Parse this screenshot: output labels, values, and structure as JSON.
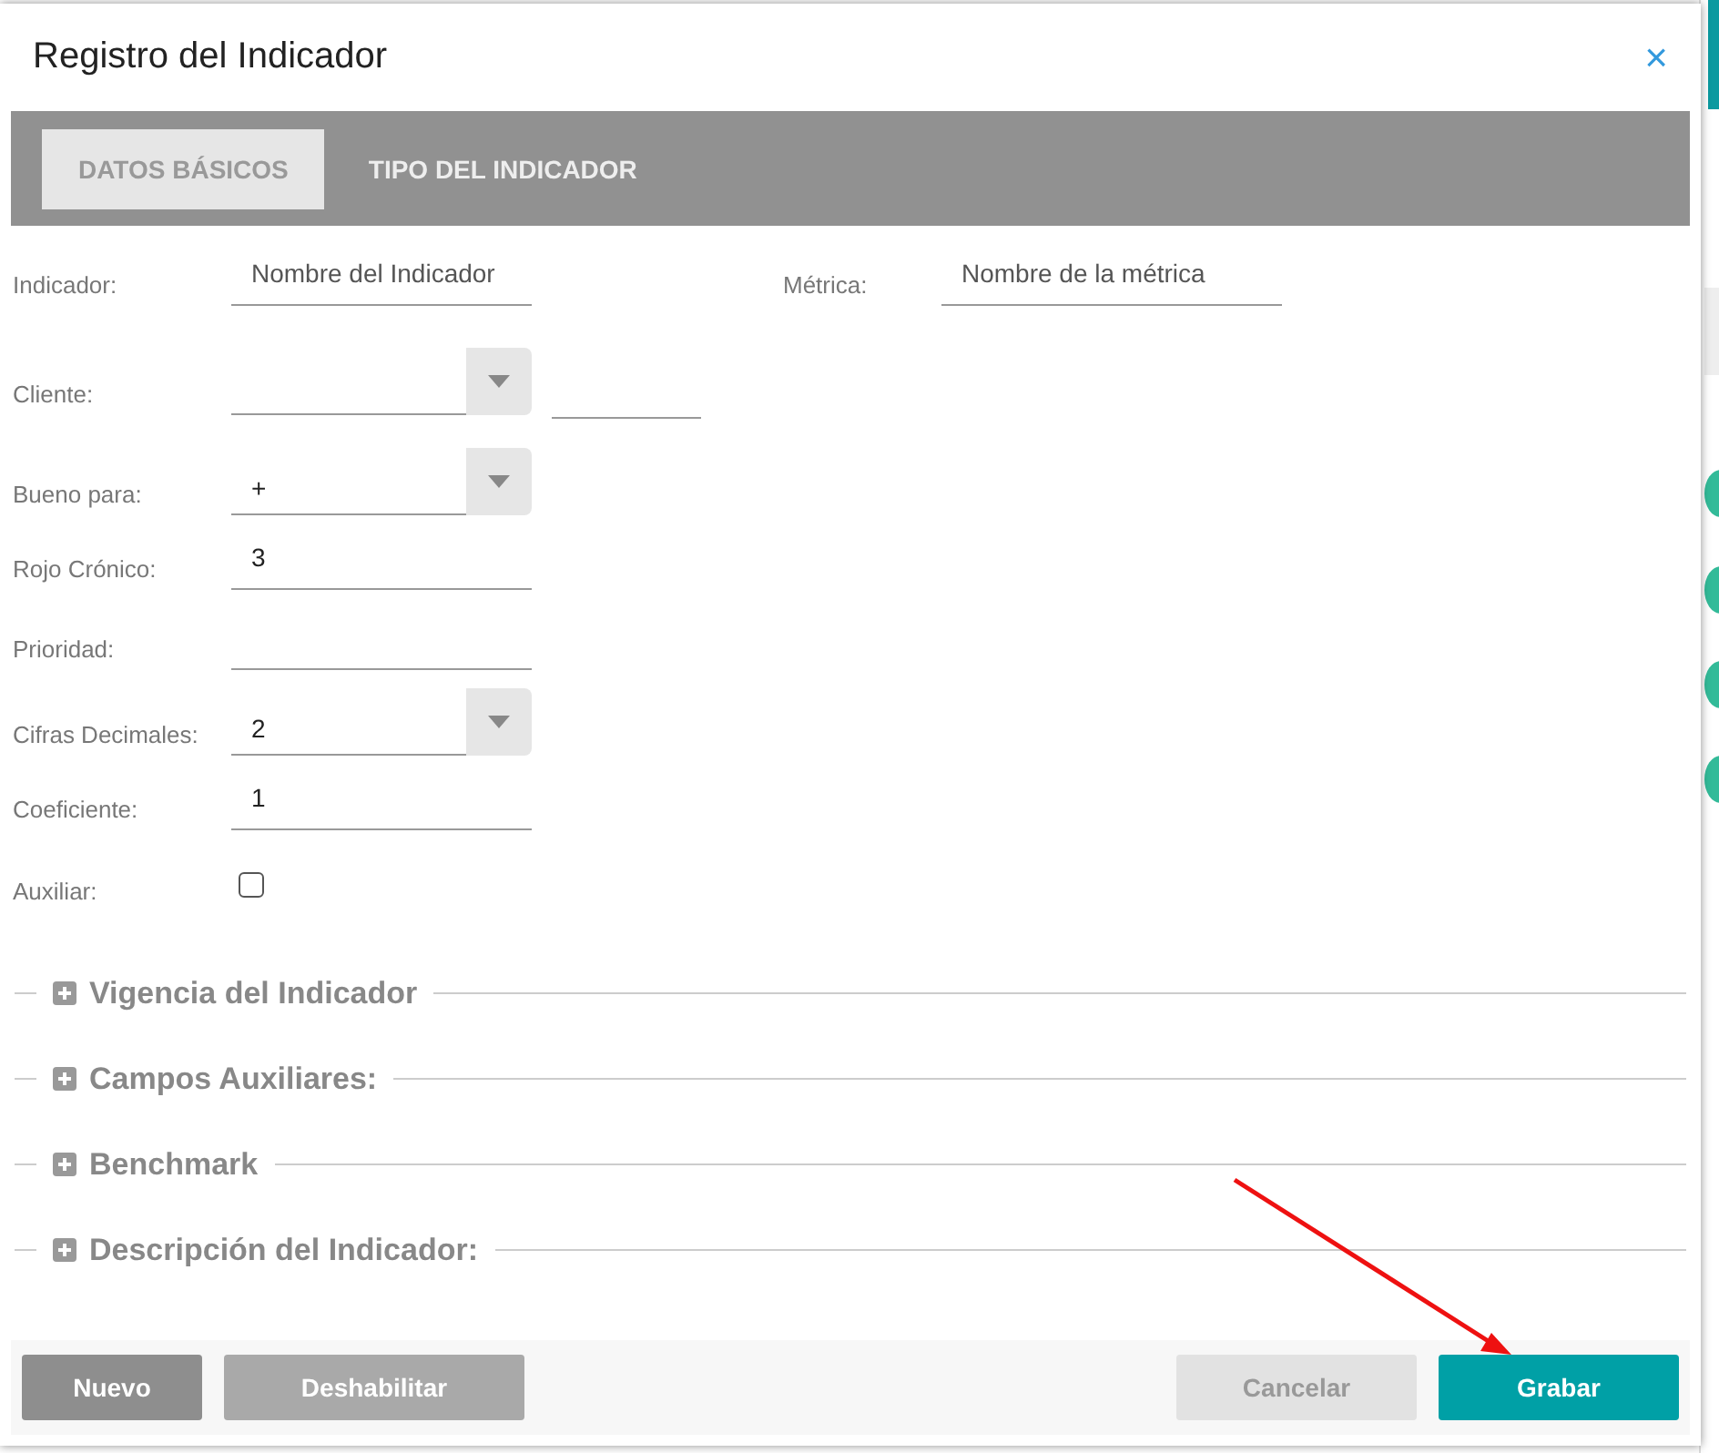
{
  "dialog": {
    "title": "Registro del Indicador",
    "close": "×"
  },
  "tabs": [
    {
      "label": "DATOS BÁSICOS",
      "selected": true
    },
    {
      "label": "TIPO DEL INDICADOR",
      "selected": false
    }
  ],
  "form": {
    "rows": [
      {
        "fields": [
          {
            "kind": "text",
            "label": "Indicador:",
            "placeholder": "Nombre del Indicador"
          },
          {
            "kind": "text",
            "label": "Métrica:",
            "placeholder": "Nombre de la métrica"
          }
        ]
      },
      {
        "fields": [
          {
            "kind": "select",
            "label": "Cliente:",
            "code_field": true
          }
        ]
      },
      {
        "fields": [
          {
            "kind": "select",
            "label": "Bueno para:",
            "value": "+"
          }
        ]
      },
      {
        "fields": [
          {
            "kind": "text",
            "label": "Rojo Crónico:",
            "value": "3"
          }
        ]
      },
      {
        "fields": [
          {
            "kind": "text",
            "label": "Prioridad:"
          }
        ]
      },
      {
        "fields": [
          {
            "kind": "select",
            "label": "Cifras Decimales:",
            "value": "2"
          }
        ]
      },
      {
        "fields": [
          {
            "kind": "text",
            "label": "Coeficiente:",
            "value": "1"
          }
        ]
      },
      {
        "fields": [
          {
            "kind": "checkbox",
            "label": "Auxiliar:",
            "checked": false
          }
        ]
      }
    ]
  },
  "sections": [
    {
      "title": "Vigencia del Indicador",
      "expanded": false
    },
    {
      "title": "Campos Auxiliares:",
      "expanded": false
    },
    {
      "title": "Benchmark",
      "expanded": false
    },
    {
      "title": "Descripción del Indicador:",
      "expanded": false
    }
  ],
  "buttons": [
    {
      "label": "Nuevo",
      "kind": "dark"
    },
    {
      "label": "Deshabilitar",
      "kind": "light"
    },
    {
      "label": "Cancelar",
      "kind": "disabled"
    },
    {
      "label": "Grabar",
      "kind": "primary"
    }
  ]
}
